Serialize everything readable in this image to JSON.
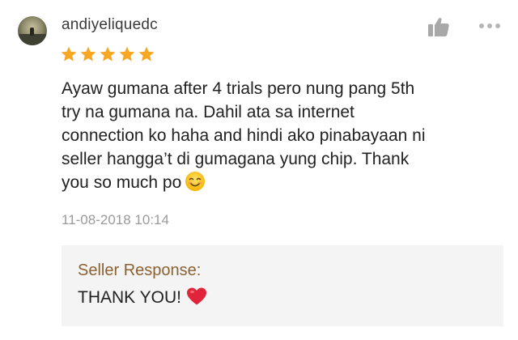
{
  "review": {
    "username": "andiyeliquedc",
    "rating": 5,
    "rating_max": 5,
    "body": "Ayaw gumana after 4 trials pero nung pang 5th\ntry na gumana na. Dahil ata sa internet\nconnection ko haha and hindi ako pinabayaan ni\nseller hangga’t di gumagana yung chip. Thank\nyou so much po",
    "body_emoji": "smiling-face-icon",
    "timestamp": "11-08-2018 10:14"
  },
  "seller_response": {
    "label": "Seller Response:",
    "text": "THANK YOU!",
    "emoji": "red-heart-icon"
  },
  "icons": {
    "like": "thumbs-up-icon",
    "more": "more-dots-icon"
  },
  "colors": {
    "star": "#f6a623",
    "response_label": "#8a6232",
    "response_bg": "#f4f4f4",
    "timestamp": "#9a9a9a",
    "heart": "#e0243a"
  }
}
